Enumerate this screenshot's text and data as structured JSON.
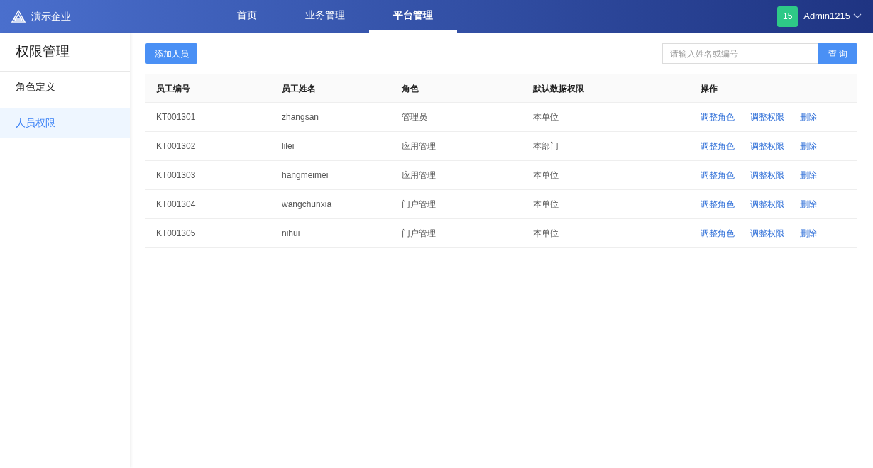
{
  "brand": {
    "name": "演示企业"
  },
  "nav": [
    {
      "label": "首页",
      "selected": false
    },
    {
      "label": "业务管理",
      "selected": false
    },
    {
      "label": "平台管理",
      "selected": true
    }
  ],
  "user": {
    "badge": "15",
    "name": "Admin1215"
  },
  "sidebar": {
    "title": "权限管理",
    "items": [
      {
        "label": "角色定义",
        "selected": false
      },
      {
        "label": "人员权限",
        "selected": true
      }
    ]
  },
  "toolbar": {
    "add_button": "添加人员",
    "search": {
      "placeholder": "请输入姓名或编号"
    },
    "search_button": "查 询"
  },
  "table": {
    "columns": [
      "员工编号",
      "员工姓名",
      "角色",
      "默认数据权限",
      "操作"
    ],
    "rows": [
      {
        "cells": [
          "KT001301",
          "zhangsan",
          "管理员",
          "本单位"
        ],
        "actions": [
          "调整角色",
          "调整权限",
          "删除"
        ]
      },
      {
        "cells": [
          "KT001302",
          "lilei",
          "应用管理",
          "本部门"
        ],
        "actions": [
          "调整角色",
          "调整权限",
          "删除"
        ]
      },
      {
        "cells": [
          "KT001303",
          "hangmeimei",
          "应用管理",
          "本单位"
        ],
        "actions": [
          "调整角色",
          "调整权限",
          "删除"
        ]
      },
      {
        "cells": [
          "KT001304",
          "wangchunxia",
          "门户管理",
          "本单位"
        ],
        "actions": [
          "调整角色",
          "调整权限",
          "删除"
        ]
      },
      {
        "cells": [
          "KT001305",
          "nihui",
          "门户管理",
          "本单位"
        ],
        "actions": [
          "调整角色",
          "调整权限",
          "删除"
        ]
      }
    ]
  }
}
